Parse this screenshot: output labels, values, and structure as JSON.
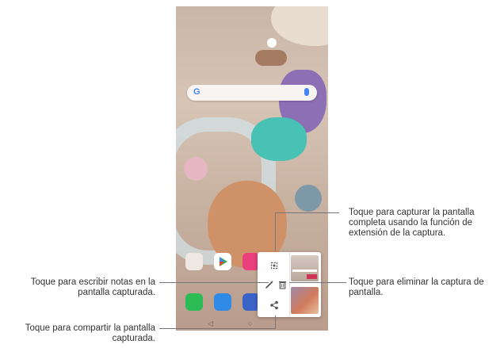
{
  "callouts": {
    "capture_full": "Toque para capturar la pantalla completa usando la función de extensión de la captura.",
    "delete": "Toque para eliminar la captura de pantalla.",
    "write_notes": "Toque para escribir notas en la pantalla capturada.",
    "share": "Toque para compartir la pantalla capturada."
  },
  "search": {
    "logo": "G"
  },
  "icons": {
    "expand": "expand-capture-icon",
    "edit": "pencil-edit-icon",
    "delete": "trash-icon",
    "share": "share-icon"
  },
  "nav": {
    "back": "◁",
    "home": "○"
  },
  "colors": {
    "line": "#777777",
    "text": "#333333",
    "accent": "#4285f4"
  }
}
